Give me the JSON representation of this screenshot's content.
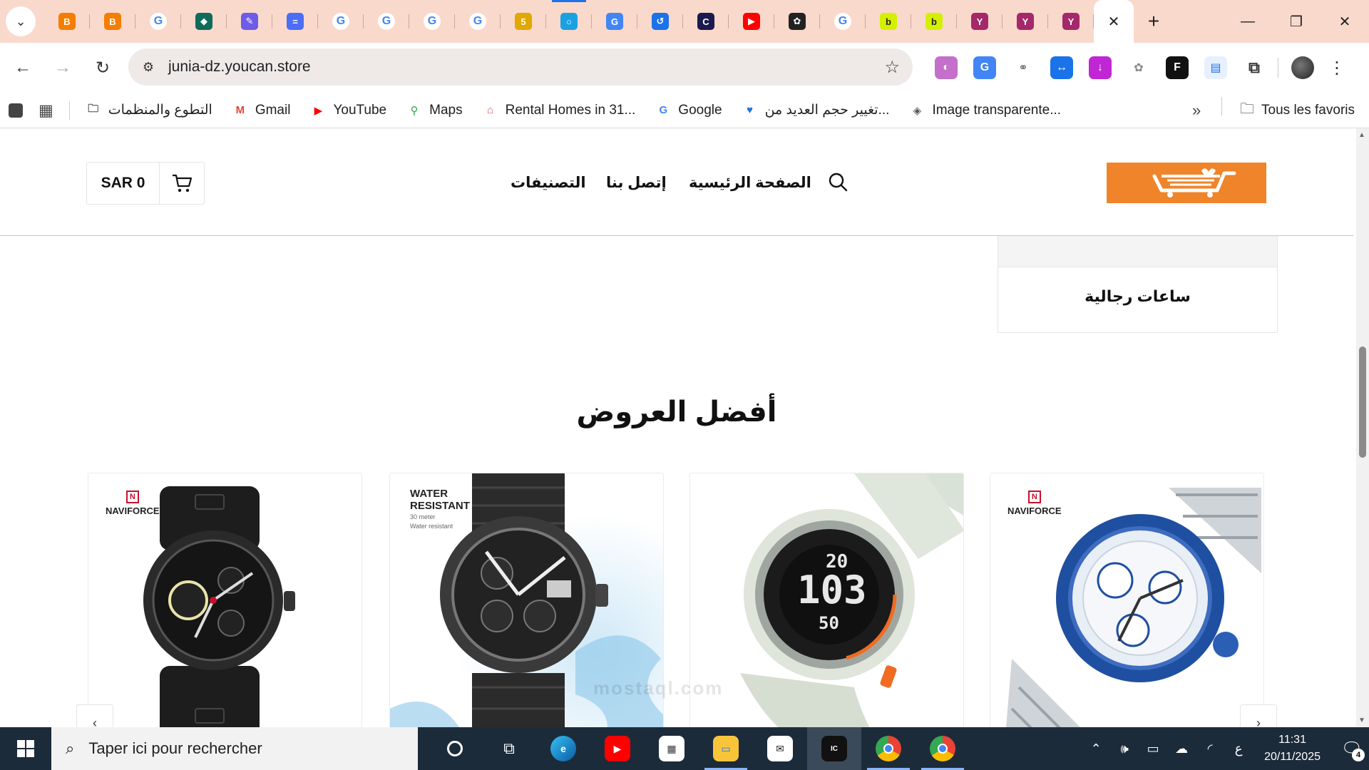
{
  "browser": {
    "tabs": [
      {
        "icon": "blogger-icon",
        "color": "#f57d00",
        "glyph": "B"
      },
      {
        "icon": "blogger-icon",
        "color": "#f57d00",
        "glyph": "B"
      },
      {
        "icon": "google-icon",
        "color": "#ffffff",
        "glyph": "G"
      },
      {
        "icon": "cube-app-icon",
        "color": "#0f6b5c",
        "glyph": "◆"
      },
      {
        "icon": "pencil-app-icon",
        "color": "#6c5ce7",
        "glyph": "✎"
      },
      {
        "icon": "chat-app-icon",
        "color": "#4c6ef5",
        "glyph": "="
      },
      {
        "icon": "google-icon",
        "color": "#ffffff",
        "glyph": "G"
      },
      {
        "icon": "google-icon",
        "color": "#ffffff",
        "glyph": "G"
      },
      {
        "icon": "google-icon",
        "color": "#ffffff",
        "glyph": "G"
      },
      {
        "icon": "google-icon",
        "color": "#ffffff",
        "glyph": "G"
      },
      {
        "icon": "five-app-icon",
        "color": "#e0a800",
        "glyph": "5"
      },
      {
        "icon": "circle-app-icon",
        "color": "#1ba1e2",
        "glyph": "○"
      },
      {
        "icon": "translate-icon",
        "color": "#4285f4",
        "glyph": "G"
      },
      {
        "icon": "history-icon",
        "color": "#1a73e8",
        "glyph": "↺"
      },
      {
        "icon": "copyright-icon",
        "color": "#1a1a4e",
        "glyph": "C"
      },
      {
        "icon": "youtube-icon",
        "color": "#ff0000",
        "glyph": "▶"
      },
      {
        "icon": "chatgpt-icon",
        "color": "#222222",
        "glyph": "✿"
      },
      {
        "icon": "google-icon",
        "color": "#ffffff",
        "glyph": "G"
      },
      {
        "icon": "lime-app-icon",
        "color": "#d4f000",
        "glyph": "b"
      },
      {
        "icon": "lime-app-icon",
        "color": "#d4f000",
        "glyph": "b"
      },
      {
        "icon": "yoast-icon",
        "color": "#a4286a",
        "glyph": "Y"
      },
      {
        "icon": "yoast-icon",
        "color": "#a4286a",
        "glyph": "Y"
      },
      {
        "icon": "yoast-icon",
        "color": "#a4286a",
        "glyph": "Y"
      }
    ],
    "url": "junia-dz.youcan.store",
    "bookmarks": [
      {
        "label": "التطوع والمنظمات",
        "icon": "folder-icon"
      },
      {
        "label": "Gmail",
        "icon": "gmail-icon"
      },
      {
        "label": "YouTube",
        "icon": "youtube-icon"
      },
      {
        "label": "Maps",
        "icon": "maps-icon"
      },
      {
        "label": "Rental Homes in 31...",
        "icon": "airbnb-icon"
      },
      {
        "label": "Google",
        "icon": "google-icon"
      },
      {
        "label": "تغيير حجم العديد من...",
        "icon": "heart-icon"
      },
      {
        "label": "Image transparente...",
        "icon": "layers-icon"
      }
    ],
    "all_bookmarks": "Tous les favoris"
  },
  "site": {
    "cart_price": "SAR 0",
    "nav": {
      "home": "الصفحة الرئيسية",
      "contact": "إتصل بنا",
      "categories": "التصنيفات"
    },
    "category_card_label": "ساعات رجالية",
    "section_title": "أفضل العروض",
    "products": [
      {
        "brand": "NAVIFORCE",
        "style": "black leather chronograph"
      },
      {
        "badge_title": "WATER RESISTANT",
        "badge_sub1": "30 meter",
        "badge_sub2": "Water resistant",
        "style": "black steel chronograph"
      },
      {
        "style": "SKMEI digital sport white"
      },
      {
        "brand": "NAVIFORCE",
        "style": "blue steel chronograph"
      }
    ],
    "watermark": "mostaql.com",
    "accent_color": "#f0842a"
  },
  "taskbar": {
    "search_placeholder": "Taper ici pour rechercher",
    "time": "11:31",
    "date": "20/11/2025",
    "lang": "ع",
    "notifications": "4"
  }
}
